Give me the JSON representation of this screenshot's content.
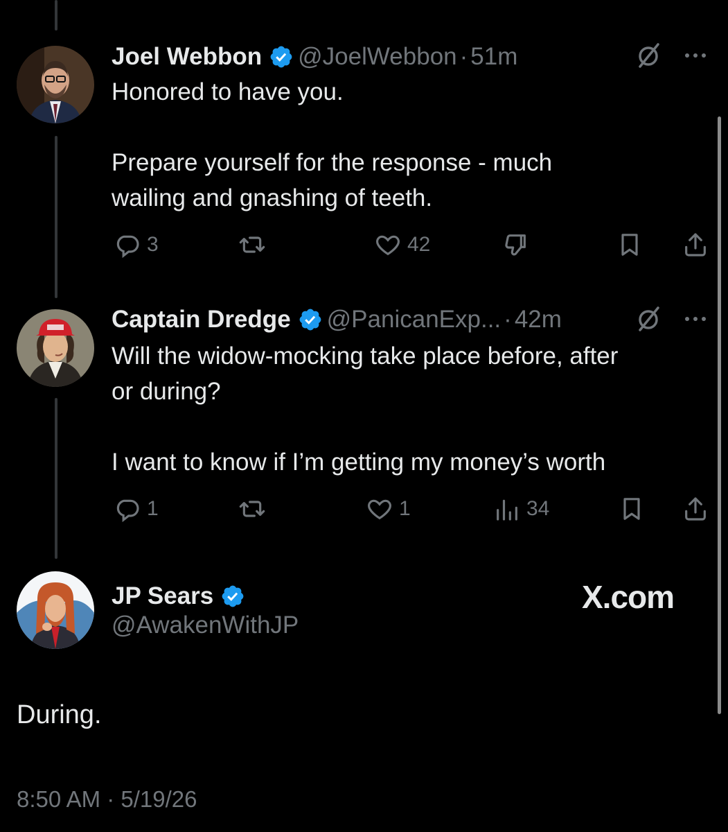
{
  "tweets": [
    {
      "name": "Joel Webbon",
      "handle": "@JoelWebbon",
      "separator": "·",
      "time": "51m",
      "text": "Honored to have you.\n\nPrepare yourself for the response - much\nwailing and gnashing of teeth.",
      "replies": "3",
      "likes": "42"
    },
    {
      "name": "Captain Dredge",
      "handle": "@PanicanExp...",
      "separator": "·",
      "time": "42m",
      "text": "Will the widow-mocking take place before, after\nor during?\n\nI want to know if I’m getting my money’s worth",
      "replies": "1",
      "likes": "1",
      "views": "34"
    }
  ],
  "main_tweet": {
    "name": "JP Sears",
    "handle": "@AwakenWithJP",
    "text": "During.",
    "timestamp": "8:50 AM · 5/19/26"
  },
  "watermark": "X.com",
  "colors": {
    "background": "#000000",
    "text": "#e7e9ea",
    "muted": "#71767b",
    "verified": "#1d9bf0"
  },
  "icons": [
    "verified-badge-icon",
    "grok-slash-icon",
    "more-dots-icon",
    "reply-icon",
    "retweet-icon",
    "like-icon",
    "dislike-icon",
    "views-icon",
    "bookmark-icon",
    "share-icon"
  ]
}
